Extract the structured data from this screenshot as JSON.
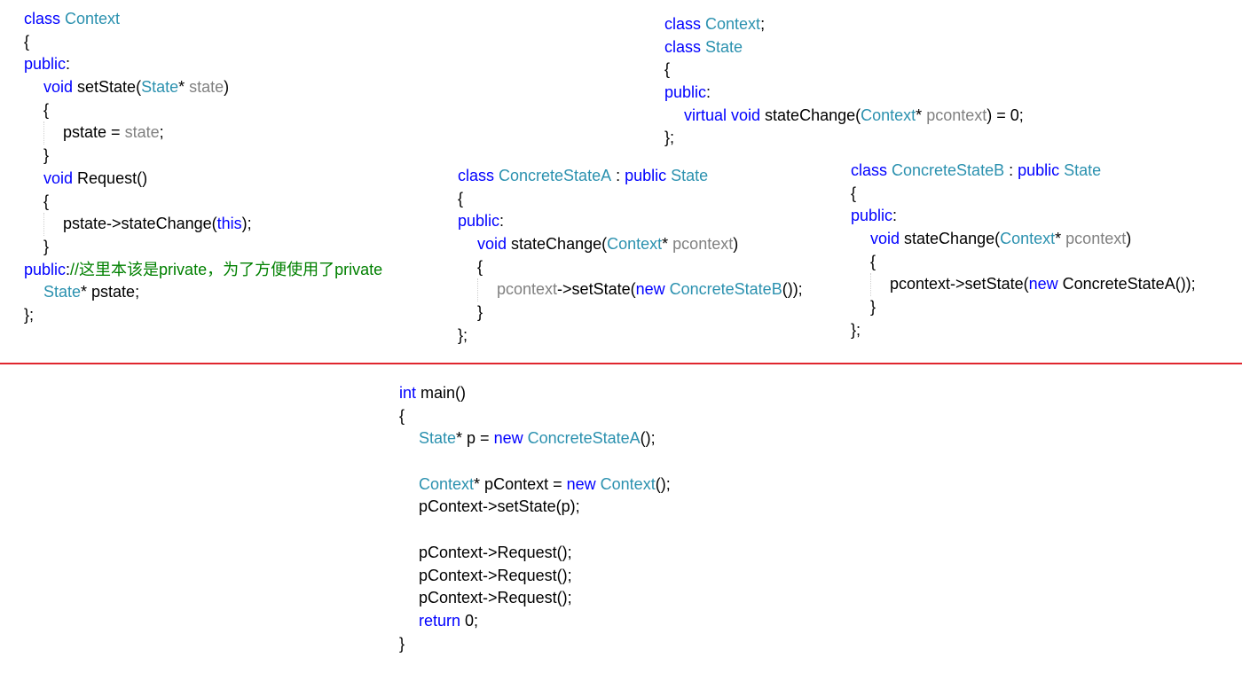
{
  "colors": {
    "keyword": "#0000ff",
    "type": "#2b91af",
    "parameter": "#808080",
    "comment": "#008000",
    "divider": "#e0262e"
  },
  "blocks": [
    {
      "id": "context-class",
      "lines": [
        {
          "indent": 0,
          "tokens": [
            [
              "class ",
              "kw"
            ],
            [
              "Context",
              "ty"
            ]
          ]
        },
        {
          "indent": 0,
          "tokens": [
            [
              "{",
              "tx"
            ]
          ]
        },
        {
          "indent": 0,
          "tokens": [
            [
              "public",
              "kw"
            ],
            [
              ":",
              "tx"
            ]
          ]
        },
        {
          "indent": 1,
          "tokens": [
            [
              "void ",
              "kw"
            ],
            [
              "setState(",
              "tx"
            ],
            [
              "State",
              "ty"
            ],
            [
              "* ",
              "tx"
            ],
            [
              "state",
              "pa"
            ],
            [
              ")",
              "tx"
            ]
          ]
        },
        {
          "indent": 1,
          "tokens": [
            [
              "{",
              "tx"
            ]
          ]
        },
        {
          "indent": 2,
          "tokens": [
            [
              "pstate = ",
              "tx"
            ],
            [
              "state",
              "pa"
            ],
            [
              ";",
              "tx"
            ]
          ]
        },
        {
          "indent": 1,
          "tokens": [
            [
              "}",
              "tx"
            ]
          ]
        },
        {
          "indent": 1,
          "tokens": [
            [
              "void ",
              "kw"
            ],
            [
              "Request()",
              "tx"
            ]
          ]
        },
        {
          "indent": 1,
          "tokens": [
            [
              "{",
              "tx"
            ]
          ]
        },
        {
          "indent": 2,
          "tokens": [
            [
              "pstate->stateChange(",
              "tx"
            ],
            [
              "this",
              "kw"
            ],
            [
              ");",
              "tx"
            ]
          ]
        },
        {
          "indent": 1,
          "tokens": [
            [
              "}",
              "tx"
            ]
          ]
        },
        {
          "indent": 0,
          "tokens": [
            [
              "public",
              "kw"
            ],
            [
              ":",
              "tx"
            ],
            [
              "//这里本该是private，为了方便使用了private",
              "cm"
            ]
          ]
        },
        {
          "indent": 1,
          "tokens": [
            [
              "State",
              "ty"
            ],
            [
              "* pstate;",
              "tx"
            ]
          ]
        },
        {
          "indent": 0,
          "tokens": [
            [
              "};",
              "tx"
            ]
          ]
        }
      ]
    },
    {
      "id": "state-class",
      "lines": [
        {
          "indent": 0,
          "tokens": [
            [
              "class ",
              "kw"
            ],
            [
              "Context",
              "ty"
            ],
            [
              ";",
              "tx"
            ]
          ]
        },
        {
          "indent": 0,
          "tokens": [
            [
              "class ",
              "kw"
            ],
            [
              "State",
              "ty"
            ]
          ]
        },
        {
          "indent": 0,
          "tokens": [
            [
              "{",
              "tx"
            ]
          ]
        },
        {
          "indent": 0,
          "tokens": [
            [
              "public",
              "kw"
            ],
            [
              ":",
              "tx"
            ]
          ]
        },
        {
          "indent": 1,
          "tokens": [
            [
              "virtual ",
              "kw"
            ],
            [
              "void ",
              "kw"
            ],
            [
              "stateChange(",
              "tx"
            ],
            [
              "Context",
              "ty"
            ],
            [
              "* ",
              "tx"
            ],
            [
              "pcontext",
              "pa"
            ],
            [
              ") = 0;",
              "tx"
            ]
          ]
        },
        {
          "indent": 0,
          "tokens": [
            [
              "};",
              "tx"
            ]
          ]
        }
      ]
    },
    {
      "id": "concrete-state-a-class",
      "lines": [
        {
          "indent": 0,
          "tokens": [
            [
              "class ",
              "kw"
            ],
            [
              "ConcreteStateA",
              "ty"
            ],
            [
              " : ",
              "tx"
            ],
            [
              "public ",
              "kw"
            ],
            [
              "State",
              "ty"
            ]
          ]
        },
        {
          "indent": 0,
          "tokens": [
            [
              "{",
              "tx"
            ]
          ]
        },
        {
          "indent": 0,
          "tokens": [
            [
              "public",
              "kw"
            ],
            [
              ":",
              "tx"
            ]
          ]
        },
        {
          "indent": 1,
          "tokens": [
            [
              "void ",
              "kw"
            ],
            [
              "stateChange(",
              "tx"
            ],
            [
              "Context",
              "ty"
            ],
            [
              "* ",
              "tx"
            ],
            [
              "pcontext",
              "pa"
            ],
            [
              ")",
              "tx"
            ]
          ]
        },
        {
          "indent": 1,
          "tokens": [
            [
              "{",
              "tx"
            ]
          ]
        },
        {
          "indent": 2,
          "tokens": [
            [
              "pcontext",
              "pa"
            ],
            [
              "->setState(",
              "tx"
            ],
            [
              "new ",
              "kw"
            ],
            [
              "ConcreteStateB",
              "ty"
            ],
            [
              "());",
              "tx"
            ]
          ]
        },
        {
          "indent": 1,
          "tokens": [
            [
              "}",
              "tx"
            ]
          ]
        },
        {
          "indent": 0,
          "tokens": [
            [
              "};",
              "tx"
            ]
          ]
        }
      ]
    },
    {
      "id": "concrete-state-b-class",
      "lines": [
        {
          "indent": 0,
          "tokens": [
            [
              "class ",
              "kw"
            ],
            [
              "ConcreteStateB",
              "ty"
            ],
            [
              " : ",
              "tx"
            ],
            [
              "public ",
              "kw"
            ],
            [
              "State",
              "ty"
            ]
          ]
        },
        {
          "indent": 0,
          "tokens": [
            [
              "{",
              "tx"
            ]
          ]
        },
        {
          "indent": 0,
          "tokens": [
            [
              "public",
              "kw"
            ],
            [
              ":",
              "tx"
            ]
          ]
        },
        {
          "indent": 1,
          "tokens": [
            [
              "void ",
              "kw"
            ],
            [
              "stateChange(",
              "tx"
            ],
            [
              "Context",
              "ty"
            ],
            [
              "* ",
              "tx"
            ],
            [
              "pcontext",
              "pa"
            ],
            [
              ")",
              "tx"
            ]
          ]
        },
        {
          "indent": 1,
          "tokens": [
            [
              "{",
              "tx"
            ]
          ]
        },
        {
          "indent": 2,
          "tokens": [
            [
              "pcontext->setState(",
              "tx"
            ],
            [
              "new ",
              "kw"
            ],
            [
              "ConcreteStateA());",
              "tx"
            ]
          ]
        },
        {
          "indent": 1,
          "tokens": [
            [
              "}",
              "tx"
            ]
          ]
        },
        {
          "indent": 0,
          "tokens": [
            [
              "};",
              "tx"
            ]
          ]
        }
      ]
    },
    {
      "id": "main-function",
      "lines": [
        {
          "indent": 0,
          "tokens": [
            [
              "int ",
              "kw"
            ],
            [
              "main()",
              "tx"
            ]
          ]
        },
        {
          "indent": 0,
          "tokens": [
            [
              "{",
              "tx"
            ]
          ]
        },
        {
          "indent": 1,
          "tokens": [
            [
              "State",
              "ty"
            ],
            [
              "* p = ",
              "tx"
            ],
            [
              "new ",
              "kw"
            ],
            [
              "ConcreteStateA",
              "ty"
            ],
            [
              "();",
              "tx"
            ]
          ]
        },
        {
          "indent": 1,
          "tokens": []
        },
        {
          "indent": 1,
          "tokens": [
            [
              "Context",
              "ty"
            ],
            [
              "* pContext = ",
              "tx"
            ],
            [
              "new ",
              "kw"
            ],
            [
              "Context",
              "ty"
            ],
            [
              "();",
              "tx"
            ]
          ]
        },
        {
          "indent": 1,
          "tokens": [
            [
              "pContext->setState(p);",
              "tx"
            ]
          ]
        },
        {
          "indent": 1,
          "tokens": []
        },
        {
          "indent": 1,
          "tokens": [
            [
              "pContext->Request();",
              "tx"
            ]
          ]
        },
        {
          "indent": 1,
          "tokens": [
            [
              "pContext->Request();",
              "tx"
            ]
          ]
        },
        {
          "indent": 1,
          "tokens": [
            [
              "pContext->Request();",
              "tx"
            ]
          ]
        },
        {
          "indent": 1,
          "tokens": [
            [
              "return ",
              "kw"
            ],
            [
              "0;",
              "tx"
            ]
          ]
        },
        {
          "indent": 0,
          "tokens": [
            [
              "}",
              "tx"
            ]
          ]
        }
      ]
    }
  ]
}
